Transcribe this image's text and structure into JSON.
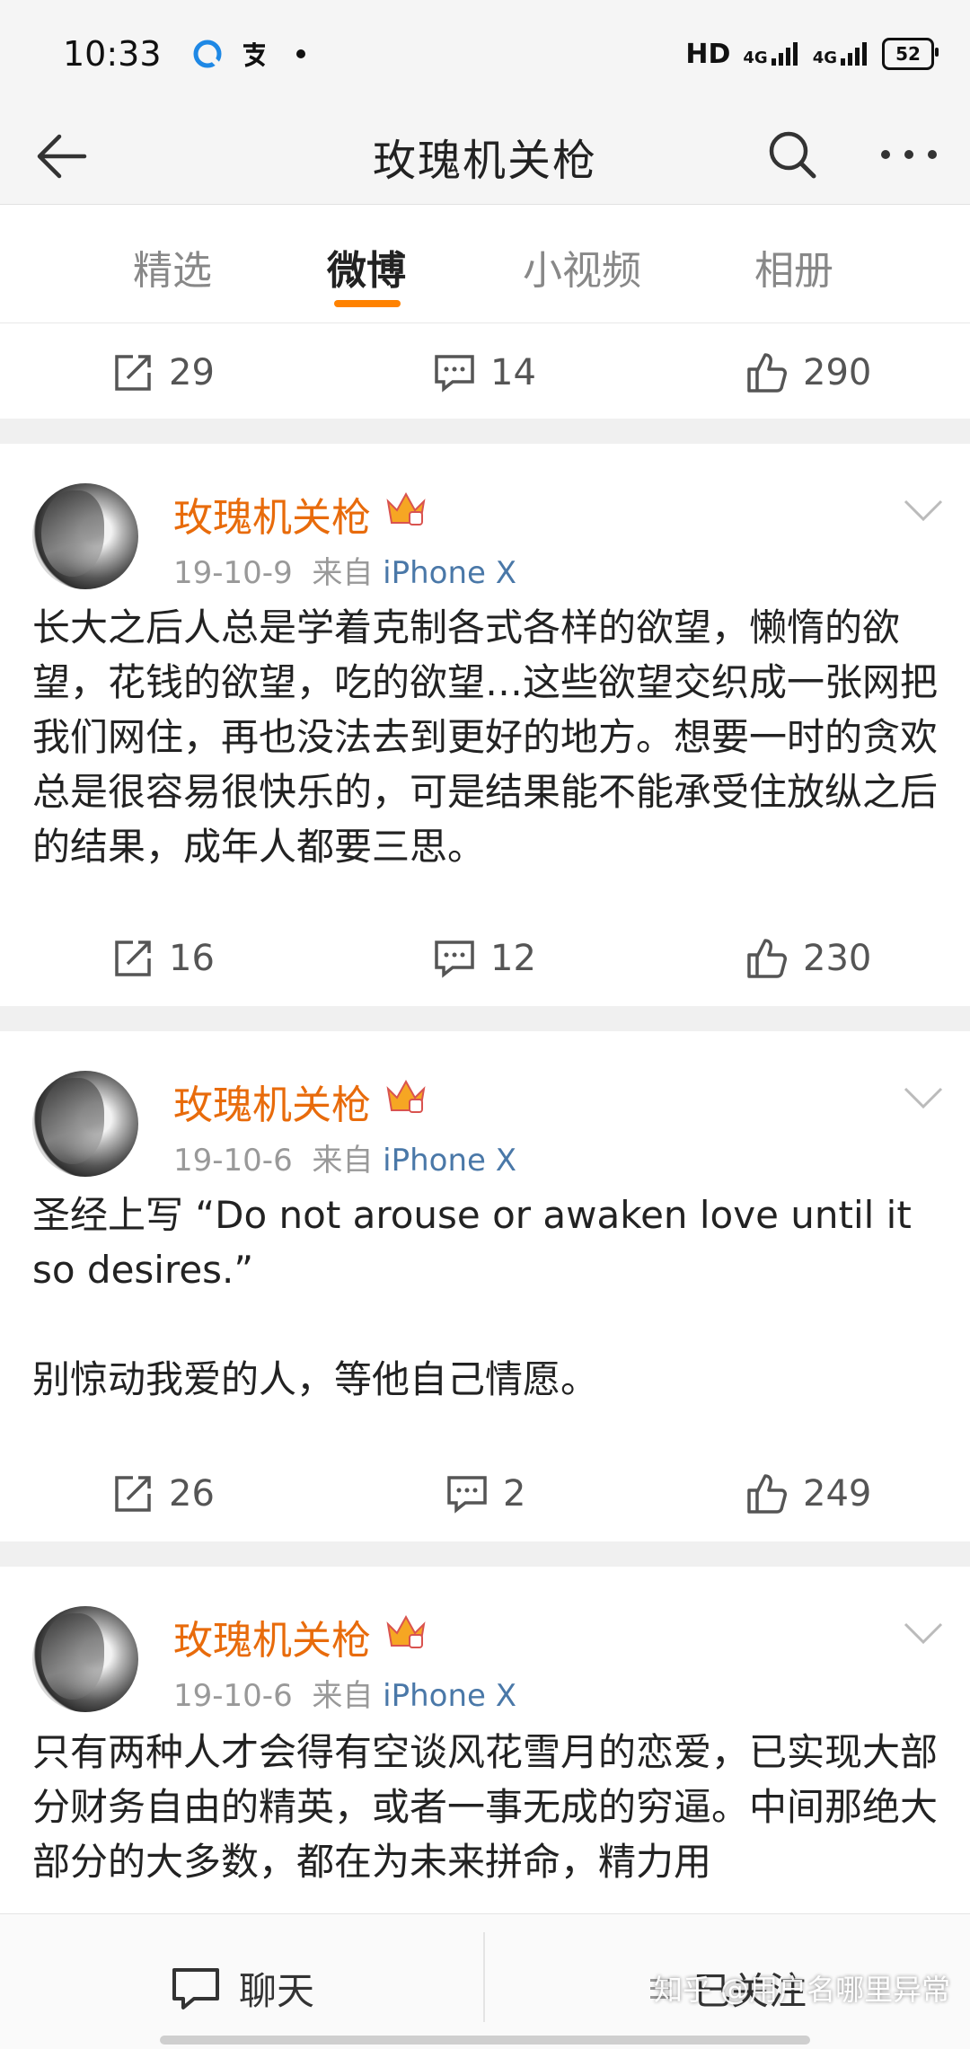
{
  "status_bar": {
    "time": "10:33",
    "network": "HD",
    "signal1": "4G",
    "signal2": "4G",
    "battery": "52"
  },
  "header": {
    "title": "玫瑰机关枪"
  },
  "tabs": [
    {
      "label": "精选"
    },
    {
      "label": "微博"
    },
    {
      "label": "小视频"
    },
    {
      "label": "相册"
    }
  ],
  "active_tab": "微博",
  "accent_color": "#ff8200",
  "name_color": "#e86b0b",
  "link_color": "#4a78a8",
  "top_actions": {
    "repost": "29",
    "comment": "14",
    "like": "290"
  },
  "posts": [
    {
      "author": "玫瑰机关枪",
      "date": "19-10-9",
      "source_prefix": "来自",
      "source": "iPhone X",
      "text": "长大之后人总是学着克制各式各样的欲望，懒惰的欲望，花钱的欲望，吃的欲望…这些欲望交织成一张网把我们网住，再也没法去到更好的地方。想要一时的贪欢总是很容易很快乐的，可是结果能不能承受住放纵之后的结果，成年人都要三思。",
      "repost": "16",
      "comment": "12",
      "like": "230"
    },
    {
      "author": "玫瑰机关枪",
      "date": "19-10-6",
      "source_prefix": "来自",
      "source": "iPhone X",
      "text": "圣经上写 “Do not arouse or awaken love until it so desires.”\n\n别惊动我爱的人，等他自己情愿。",
      "repost": "26",
      "comment": "2",
      "like": "249"
    },
    {
      "author": "玫瑰机关枪",
      "date": "19-10-6",
      "source_prefix": "来自",
      "source": "iPhone X",
      "text": "只有两种人才会得有空谈风花雪月的恋爱，已实现大部分财务自由的精英，或者一事无成的穷逼。中间那绝大部分的大多数，都在为未来拼命，精力用"
    }
  ],
  "bottom_bar": {
    "chat_label": "聊天",
    "follow_label": "已关注"
  },
  "watermark": "知乎 @用户名哪里异常"
}
